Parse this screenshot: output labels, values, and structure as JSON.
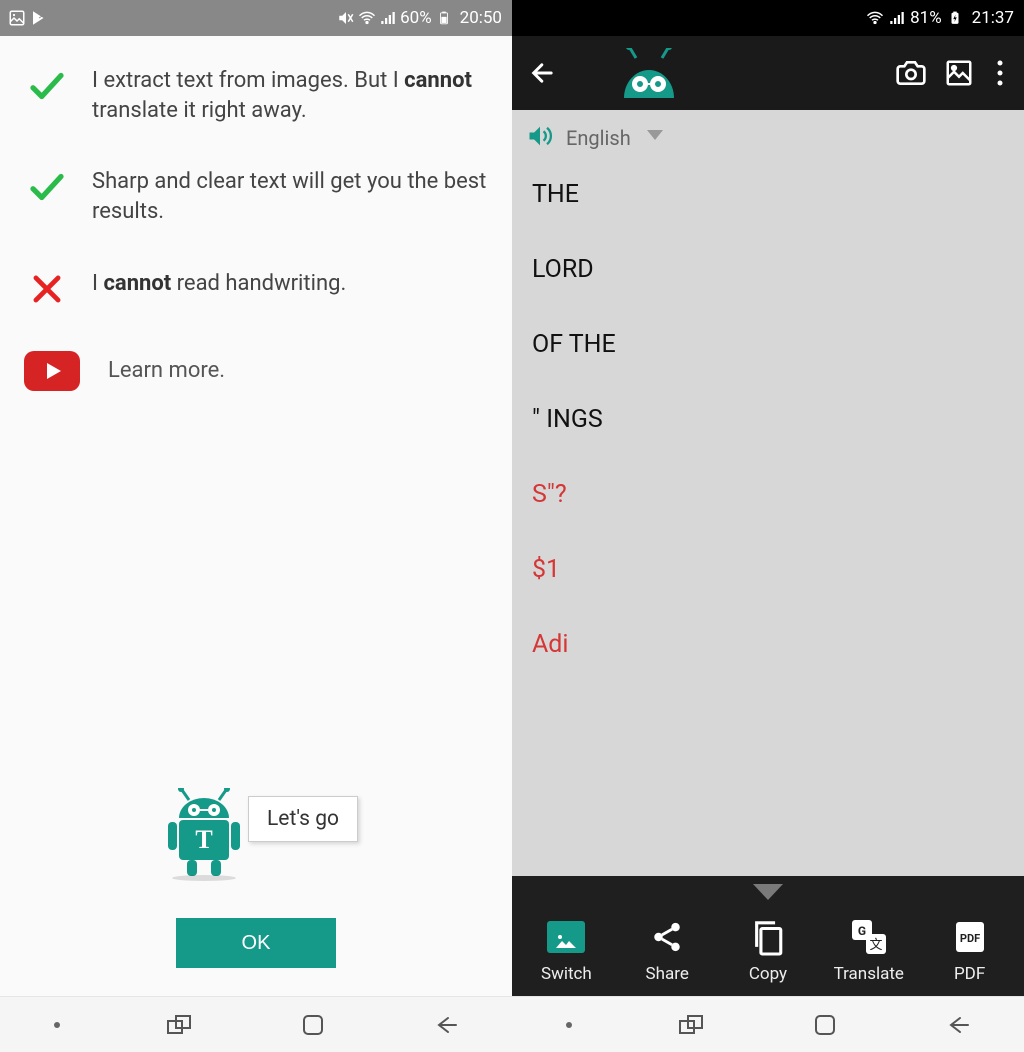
{
  "left": {
    "status": {
      "battery": "60%",
      "time": "20:50"
    },
    "tips": [
      {
        "kind": "check",
        "pre": "I extract text from images. But I ",
        "bold": "cannot",
        "post": " translate it right away."
      },
      {
        "kind": "check",
        "pre": "Sharp and clear text will get you the best results.",
        "bold": "",
        "post": ""
      },
      {
        "kind": "cross",
        "pre": "I ",
        "bold": "cannot",
        "post": " read handwriting."
      }
    ],
    "learn_more": "Learn more.",
    "speech": "Let's go",
    "ok": "OK"
  },
  "right": {
    "status": {
      "battery": "81%",
      "time": "21:37"
    },
    "language": "English",
    "lines": [
      {
        "text": "THE",
        "color": "black"
      },
      {
        "text": "LORD",
        "color": "black"
      },
      {
        "text": "OF THE",
        "color": "black"
      },
      {
        "text": "\" INGS",
        "color": "black"
      },
      {
        "text": "S\"?",
        "color": "red"
      },
      {
        "text": "$1",
        "color": "red"
      },
      {
        "text": "Adi",
        "color": "red"
      }
    ],
    "actions": {
      "switch": "Switch",
      "share": "Share",
      "copy": "Copy",
      "translate": "Translate",
      "pdf": "PDF"
    }
  }
}
